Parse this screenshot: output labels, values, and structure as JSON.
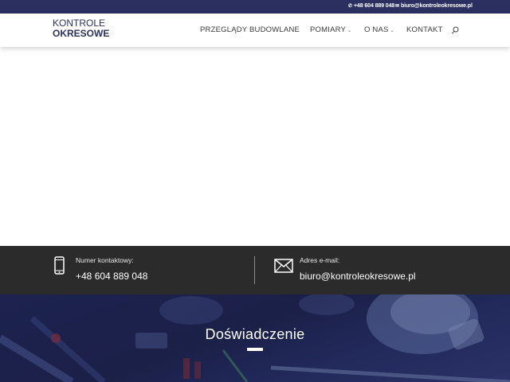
{
  "topbar": {
    "phone": "+48 604 889 048",
    "email": "biuro@kontroleokresowe.pl"
  },
  "logo": {
    "line1": "KONTROLE",
    "line2": "OKRESOWE"
  },
  "nav": {
    "items": [
      {
        "label": "PRZEGLĄDY BUDOWLANE"
      },
      {
        "label": "POMIARY"
      },
      {
        "label": "O NAS"
      },
      {
        "label": "KONTAKT"
      }
    ],
    "dropdown_icon": "chevron-down-icon",
    "search_icon": "search-icon"
  },
  "contact_strip": {
    "phone_label": "Numer kontaktowy:",
    "phone_value": "+48 604 889 048",
    "email_label": "Adres e-mail:",
    "email_value": "biuro@kontroleokresowe.pl"
  },
  "hero": {
    "title": "Doświadczenie"
  },
  "colors": {
    "brand": "#2c3060",
    "strip": "#2b2b2b",
    "hero_overlay": "#1d2250"
  }
}
